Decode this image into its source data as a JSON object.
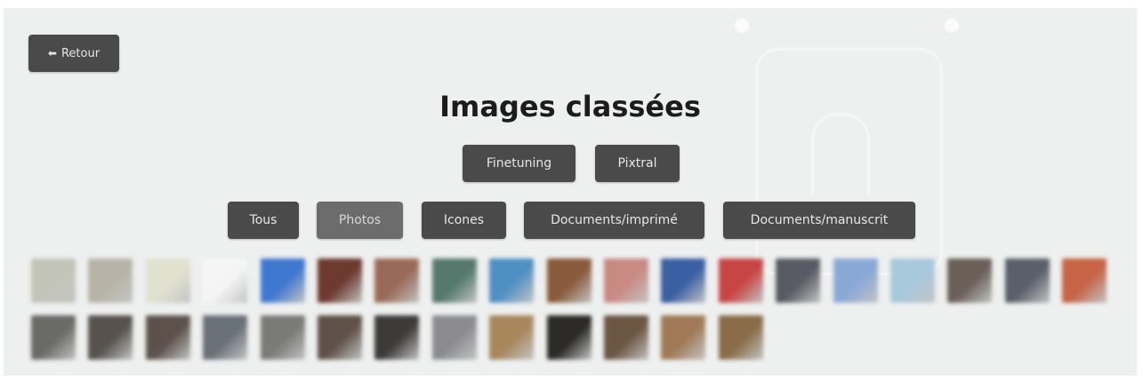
{
  "nav": {
    "back_label": "Retour",
    "back_icon": "arrow-left-icon"
  },
  "page": {
    "title": "Images classées"
  },
  "models": [
    {
      "label": "Finetuning",
      "active": false
    },
    {
      "label": "Pixtral",
      "active": false
    }
  ],
  "categories": [
    {
      "label": "Tous",
      "active": false
    },
    {
      "label": "Photos",
      "active": true
    },
    {
      "label": "Icones",
      "active": false
    },
    {
      "label": "Documents/imprimé",
      "active": false
    },
    {
      "label": "Documents/manuscrit",
      "active": false
    }
  ],
  "thumbnails": {
    "row1": [
      "#c2c4b8",
      "#b7b3a6",
      "#e1e1d0",
      "#f5f5f5",
      "#3f78cf",
      "#6d3a2f",
      "#9a6a58",
      "#557a6d",
      "#4f90c3",
      "#8a5a3c",
      "#c98a84",
      "#3a5fa3",
      "#c84545",
      "#5a5a64",
      "#8aa8d6",
      "#a8c8dc",
      "#6a6058",
      "#5a5f6a",
      "#c66445"
    ],
    "row2": [
      "#6a6a66",
      "#57524e",
      "#5d514c",
      "#6a7078",
      "#7a7a76",
      "#5f5147",
      "#3e3a3a",
      "#8c8c90",
      "#a8875c",
      "#2c2a28",
      "#6b5543",
      "#a07a56",
      "#8a6c48"
    ]
  },
  "colors": {
    "background": "#eef0ef",
    "button": "#4a4a4a",
    "button_active": "#6c6c6c",
    "title": "#1c1c1c"
  }
}
